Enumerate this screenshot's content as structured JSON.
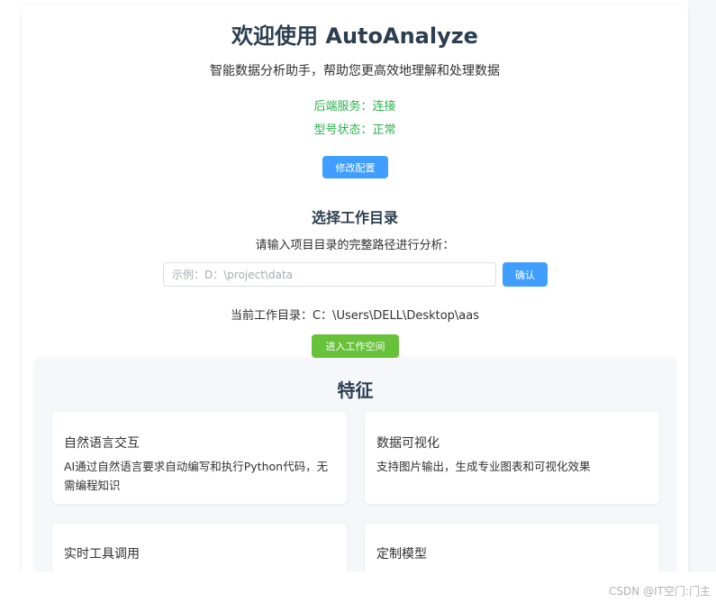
{
  "header": {
    "title": "欢迎使用 AutoAnalyze",
    "subtitle": "智能数据分析助手，帮助您更高效地理解和处理数据"
  },
  "status": {
    "backend": "后端服务：连接",
    "model": "型号状态：正常",
    "color": "#2bb24c"
  },
  "config": {
    "edit_label": "修改配置"
  },
  "workspace": {
    "section_title": "选择工作目录",
    "hint": "请输入项目目录的完整路径进行分析：",
    "input_value": "",
    "input_placeholder": "示例：D：\\project\\data",
    "confirm_label": "确认",
    "current_dir": "当前工作目录：C：\\Users\\DELL\\Desktop\\aas",
    "enter_label": "进入工作空间"
  },
  "features": {
    "title": "特征",
    "items": [
      {
        "title": "自然语言交互",
        "desc": "AI通过自然语言要求自动编写和执行Python代码，无需编程知识"
      },
      {
        "title": "数据可视化",
        "desc": "支持图片输出，生成专业图表和可视化效果"
      },
      {
        "title": "实时工具调用",
        "desc": ""
      },
      {
        "title": "定制模型",
        "desc": ""
      }
    ]
  },
  "watermark": "CSDN @IT空门:门主",
  "colors": {
    "primary": "#409eff",
    "success": "#67c23a",
    "heading": "#2c3e50"
  }
}
